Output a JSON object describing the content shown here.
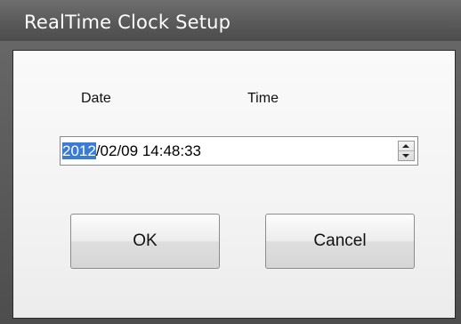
{
  "window": {
    "title": "RealTime Clock Setup"
  },
  "labels": {
    "date": "Date",
    "time": "Time"
  },
  "datetime_field": {
    "selected_part": "2012",
    "rest": "/02/09 14:48:33"
  },
  "buttons": {
    "ok": "OK",
    "cancel": "Cancel"
  },
  "icons": {
    "spinner_up": "up-arrow-icon",
    "spinner_down": "down-arrow-icon"
  },
  "colors": {
    "selection": "#3a7bd5",
    "titlebar": "#5a5a5a"
  }
}
